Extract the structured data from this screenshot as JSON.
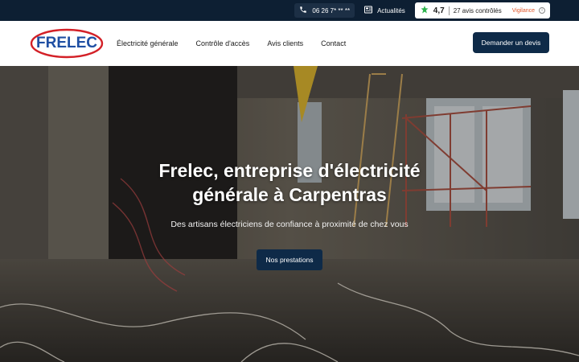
{
  "topbar": {
    "phone": "06 26 7* ** **",
    "news_label": "Actualités",
    "rating_score": "4,7",
    "rating_count": "27 avis contrôlés",
    "vigilance": "Vigilance",
    "info_icon": "i"
  },
  "header": {
    "logo_text": "FRELEC",
    "nav": [
      {
        "label": "Électricité générale"
      },
      {
        "label": "Contrôle d'accès"
      },
      {
        "label": "Avis clients"
      },
      {
        "label": "Contact"
      }
    ],
    "cta_label": "Demander un devis"
  },
  "hero": {
    "title_line1": "Frelec, entreprise d'électricité",
    "title_line2": "générale à Carpentras",
    "subtitle": "Des artisans électriciens de confiance à proximité de chez vous",
    "button_label": "Nos prestations"
  },
  "colors": {
    "topbar_bg": "#0d1f33",
    "brand_navy": "#0e2a48",
    "logo_blue": "#1f4fa3",
    "logo_red": "#d32027",
    "rating_green": "#2bb24c",
    "vigilance_orange": "#e2572b"
  },
  "icons": {
    "phone": "phone-icon",
    "news": "newspaper-icon",
    "rating": "star-leaf-icon",
    "info": "info-icon"
  }
}
